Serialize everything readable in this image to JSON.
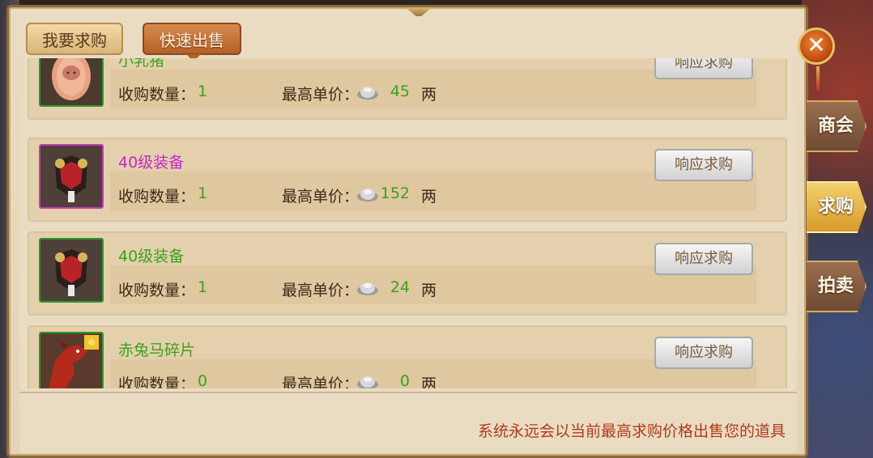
{
  "tabs": {
    "buy": "我要求购",
    "sell": "快速出售"
  },
  "close_label": "✕",
  "side_tabs": [
    {
      "label": "商会",
      "active": false
    },
    {
      "label": "求购",
      "active": true
    },
    {
      "label": "拍卖",
      "active": false
    }
  ],
  "labels": {
    "qty": "收购数量：",
    "price": "最高单价：",
    "unit": "两",
    "respond": "响应求购"
  },
  "items": [
    {
      "name": "小乳猪",
      "qty": "1",
      "price": "45",
      "rarity": "green",
      "icon": "piglet-egg-icon"
    },
    {
      "name": "40级装备",
      "qty": "1",
      "price": "152",
      "rarity": "purple",
      "icon": "armor-icon"
    },
    {
      "name": "40级装备",
      "qty": "1",
      "price": "24",
      "rarity": "green",
      "icon": "armor-icon"
    },
    {
      "name": "赤兔马碎片",
      "qty": "0",
      "price": "0",
      "rarity": "green",
      "icon": "red-horse-fragment-icon"
    }
  ],
  "footer_note": "系统永远会以当前最高求购价格出售您的道具",
  "colors": {
    "green_text": "#3da11a",
    "purple_text": "#c829c8",
    "note_text": "#b23a1a",
    "active_tab": "#b3602a"
  }
}
